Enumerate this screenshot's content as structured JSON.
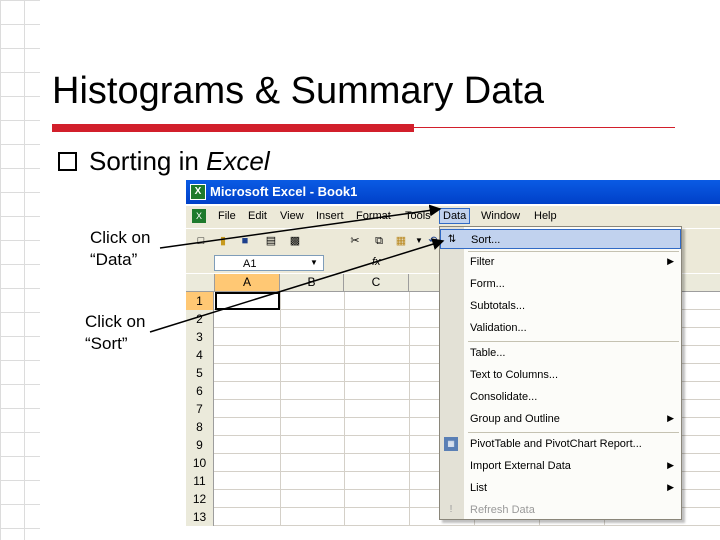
{
  "slide": {
    "title": "Histograms & Summary Data",
    "bullet": "Sorting in ",
    "bullet_emph": "Excel",
    "note_data": [
      "Click on",
      "“Data”"
    ],
    "note_sort": [
      "Click on",
      "“Sort”"
    ],
    "accent": "#d21f2b"
  },
  "window": {
    "title": "Microsoft Excel - Book1",
    "menu": [
      "File",
      "Edit",
      "View",
      "Insert",
      "Format",
      "Tools",
      "Data",
      "Window",
      "Help"
    ],
    "name_box": "A1",
    "columns": [
      "A",
      "B",
      "C"
    ],
    "rows": [
      "1",
      "2",
      "3",
      "4",
      "5",
      "6",
      "7",
      "8",
      "9",
      "10",
      "11",
      "12",
      "13"
    ]
  },
  "data_menu": {
    "items": [
      {
        "label": "Sort...",
        "icon": "sort-icon",
        "highlighted": true,
        "submenu": false
      },
      {
        "label": "Filter",
        "submenu": true
      },
      {
        "label": "Form...",
        "submenu": false
      },
      {
        "label": "Subtotals...",
        "submenu": false
      },
      {
        "label": "Validation...",
        "submenu": false
      },
      {
        "label": "Table...",
        "submenu": false
      },
      {
        "label": "Text to Columns...",
        "submenu": false
      },
      {
        "label": "Consolidate...",
        "submenu": false
      },
      {
        "label": "Group and Outline",
        "submenu": true
      },
      {
        "label": "PivotTable and PivotChart Report...",
        "icon": "pivot-icon",
        "submenu": false
      },
      {
        "label": "Import External Data",
        "submenu": true
      },
      {
        "label": "List",
        "submenu": true
      },
      {
        "label": "Refresh Data",
        "icon": "refresh-icon",
        "disabled": true,
        "submenu": false
      }
    ],
    "highlight_color": "#c1d2ee"
  }
}
